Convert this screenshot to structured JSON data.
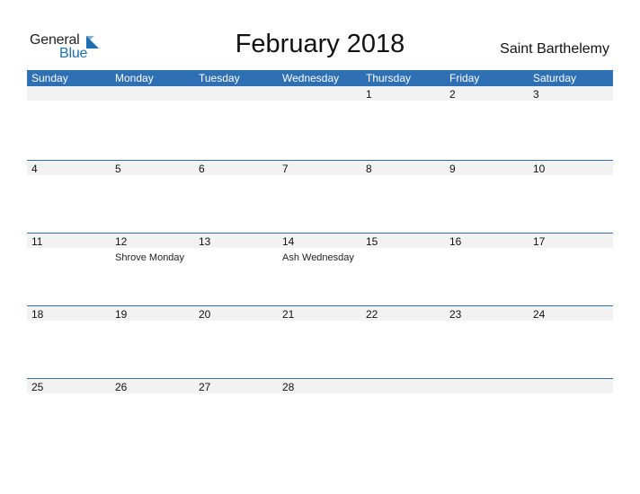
{
  "logo": {
    "word1": "General",
    "word2": "Blue",
    "flag_color": "#1f6fb5"
  },
  "title": "February 2018",
  "region": "Saint Barthelemy",
  "colors": {
    "header_bg": "#2f6fb4",
    "header_text": "#ffffff",
    "date_band": "#f2f2f2"
  },
  "weekdays": [
    "Sunday",
    "Monday",
    "Tuesday",
    "Wednesday",
    "Thursday",
    "Friday",
    "Saturday"
  ],
  "weeks": [
    [
      {
        "day": ""
      },
      {
        "day": ""
      },
      {
        "day": ""
      },
      {
        "day": ""
      },
      {
        "day": "1"
      },
      {
        "day": "2"
      },
      {
        "day": "3"
      }
    ],
    [
      {
        "day": "4"
      },
      {
        "day": "5"
      },
      {
        "day": "6"
      },
      {
        "day": "7"
      },
      {
        "day": "8"
      },
      {
        "day": "9"
      },
      {
        "day": "10"
      }
    ],
    [
      {
        "day": "11"
      },
      {
        "day": "12",
        "event": "Shrove Monday"
      },
      {
        "day": "13"
      },
      {
        "day": "14",
        "event": "Ash Wednesday"
      },
      {
        "day": "15"
      },
      {
        "day": "16"
      },
      {
        "day": "17"
      }
    ],
    [
      {
        "day": "18"
      },
      {
        "day": "19"
      },
      {
        "day": "20"
      },
      {
        "day": "21"
      },
      {
        "day": "22"
      },
      {
        "day": "23"
      },
      {
        "day": "24"
      }
    ],
    [
      {
        "day": "25"
      },
      {
        "day": "26"
      },
      {
        "day": "27"
      },
      {
        "day": "28"
      },
      {
        "day": ""
      },
      {
        "day": ""
      },
      {
        "day": ""
      }
    ]
  ]
}
